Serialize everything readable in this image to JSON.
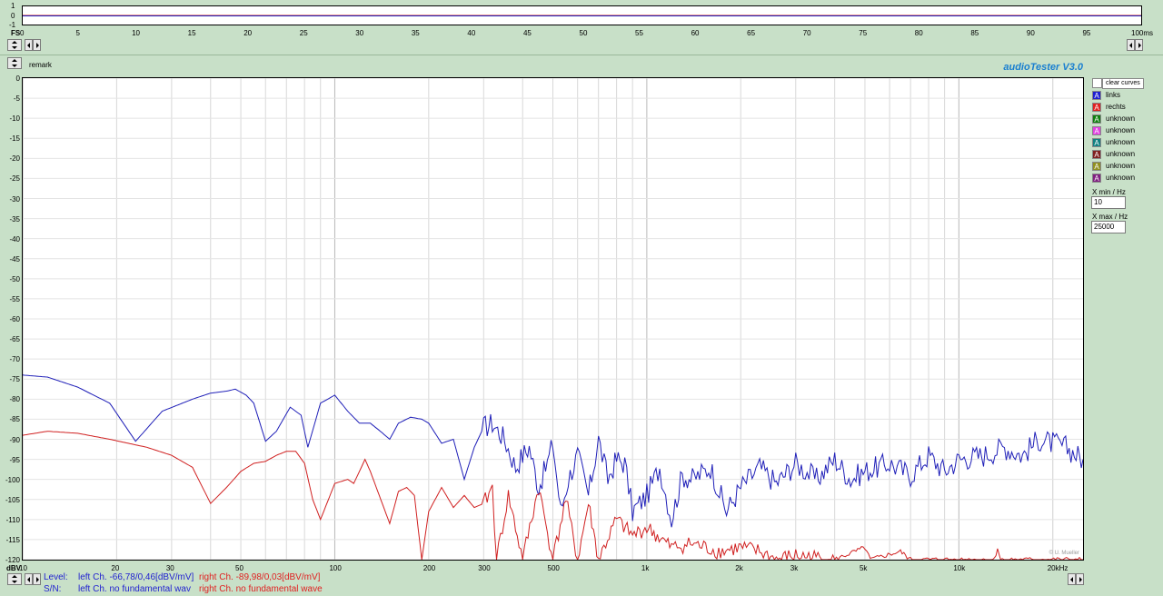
{
  "scope": {
    "fs_label": "FS",
    "y_ticks": [
      "1",
      "0",
      "-1"
    ],
    "x_ticks": [
      "0",
      "5",
      "10",
      "15",
      "20",
      "25",
      "30",
      "35",
      "40",
      "45",
      "50",
      "55",
      "60",
      "65",
      "70",
      "75",
      "80",
      "85",
      "90",
      "95",
      "100ms"
    ]
  },
  "remark_label": "remark",
  "app_title": "audioTester  V3.0",
  "clear_curves_label": "clear curves",
  "legend": [
    {
      "glyph": "A",
      "name": "links",
      "color": "#1f1fd0"
    },
    {
      "glyph": "A",
      "name": "rechts",
      "color": "#e02020"
    },
    {
      "glyph": "A",
      "name": "unknown",
      "color": "#108010"
    },
    {
      "glyph": "A",
      "name": "unknown",
      "color": "#e040e0"
    },
    {
      "glyph": "A",
      "name": "unknown",
      "color": "#108080"
    },
    {
      "glyph": "A",
      "name": "unknown",
      "color": "#802020"
    },
    {
      "glyph": "A",
      "name": "unknown",
      "color": "#909020"
    },
    {
      "glyph": "A",
      "name": "unknown",
      "color": "#802080"
    }
  ],
  "xmin_label": "X min / Hz",
  "xmin_value": "10",
  "xmax_label": "X max / Hz",
  "xmax_value": "25000",
  "watermark": "© U. Mueller",
  "status": {
    "level_label": "Level:",
    "level_left": "left Ch.  -66,78/0,46[dBV/mV]",
    "level_right": "right Ch.  -89,98/0,03[dBV/mV]",
    "sn_label": "S/N:",
    "sn_left": "left Ch.  no fundamental wav",
    "sn_right": "right Ch.  no fundamental wave"
  },
  "chart_data": {
    "type": "line",
    "x_scale": "log",
    "xlim": [
      10,
      25000
    ],
    "ylim": [
      -120,
      0
    ],
    "ylabel": "dBV",
    "x_tick_labels": [
      "10",
      "20",
      "30",
      "50",
      "100",
      "200",
      "300",
      "500",
      "1k",
      "2k",
      "3k",
      "5k",
      "10k",
      "20kHz"
    ],
    "y_tick_labels": [
      "0",
      "-5",
      "-10",
      "-15",
      "-20",
      "-25",
      "-30",
      "-35",
      "-40",
      "-45",
      "-50",
      "-55",
      "-60",
      "-65",
      "-70",
      "-75",
      "-80",
      "-85",
      "-90",
      "-95",
      "-100",
      "-105",
      "-110",
      "-115",
      "-120"
    ],
    "grid": true,
    "series": [
      {
        "name": "links",
        "color": "#1f1fb8",
        "points": [
          [
            10,
            -74
          ],
          [
            12,
            -74.5
          ],
          [
            15,
            -77
          ],
          [
            19,
            -81
          ],
          [
            23,
            -90.5
          ],
          [
            28,
            -83
          ],
          [
            35,
            -80
          ],
          [
            40,
            -78.5
          ],
          [
            45,
            -78
          ],
          [
            48,
            -77.5
          ],
          [
            52,
            -79
          ],
          [
            55,
            -81
          ],
          [
            60,
            -90.5
          ],
          [
            65,
            -88
          ],
          [
            72,
            -82
          ],
          [
            78,
            -84
          ],
          [
            82,
            -92
          ],
          [
            90,
            -81
          ],
          [
            95,
            -80
          ],
          [
            100,
            -79
          ],
          [
            110,
            -83
          ],
          [
            120,
            -86
          ],
          [
            130,
            -86
          ],
          [
            140,
            -88
          ],
          [
            150,
            -90
          ],
          [
            160,
            -86
          ],
          [
            175,
            -84.5
          ],
          [
            190,
            -85
          ],
          [
            200,
            -86
          ],
          [
            220,
            -91
          ],
          [
            240,
            -90
          ],
          [
            260,
            -100
          ],
          [
            280,
            -92
          ],
          [
            300,
            -87
          ],
          [
            320,
            -86
          ],
          [
            350,
            -90
          ],
          [
            380,
            -97
          ],
          [
            400,
            -94
          ],
          [
            420,
            -92
          ],
          [
            450,
            -102
          ],
          [
            480,
            -96
          ],
          [
            500,
            -91
          ],
          [
            530,
            -108
          ],
          [
            560,
            -100
          ],
          [
            600,
            -94
          ],
          [
            650,
            -104
          ],
          [
            700,
            -90
          ],
          [
            750,
            -100
          ],
          [
            800,
            -95
          ],
          [
            850,
            -96
          ],
          [
            900,
            -108
          ],
          [
            1000,
            -104
          ],
          [
            1100,
            -97
          ],
          [
            1200,
            -110
          ],
          [
            1300,
            -99
          ],
          [
            1400,
            -100
          ],
          [
            1600,
            -97
          ],
          [
            1800,
            -108
          ],
          [
            2000,
            -102
          ],
          [
            2300,
            -97
          ],
          [
            2600,
            -101
          ],
          [
            3000,
            -96
          ],
          [
            3500,
            -100
          ],
          [
            4000,
            -95
          ],
          [
            4500,
            -100
          ],
          [
            5000,
            -98
          ],
          [
            6000,
            -96
          ],
          [
            7000,
            -99
          ],
          [
            8000,
            -94
          ],
          [
            9000,
            -98
          ],
          [
            10000,
            -95
          ],
          [
            12000,
            -94
          ],
          [
            14000,
            -92
          ],
          [
            16000,
            -94
          ],
          [
            18000,
            -90
          ],
          [
            20000,
            -91
          ],
          [
            22000,
            -92
          ],
          [
            25000,
            -95
          ]
        ]
      },
      {
        "name": "rechts",
        "color": "#d02020",
        "points": [
          [
            10,
            -89
          ],
          [
            12,
            -88
          ],
          [
            15,
            -88.5
          ],
          [
            19,
            -90
          ],
          [
            25,
            -92
          ],
          [
            30,
            -94
          ],
          [
            35,
            -97
          ],
          [
            40,
            -106
          ],
          [
            45,
            -102
          ],
          [
            50,
            -98
          ],
          [
            55,
            -96
          ],
          [
            60,
            -95.5
          ],
          [
            65,
            -94
          ],
          [
            70,
            -93
          ],
          [
            75,
            -93
          ],
          [
            80,
            -96
          ],
          [
            85,
            -105
          ],
          [
            90,
            -110
          ],
          [
            100,
            -101
          ],
          [
            110,
            -100
          ],
          [
            115,
            -101
          ],
          [
            120,
            -98
          ],
          [
            125,
            -95
          ],
          [
            130,
            -98
          ],
          [
            150,
            -111
          ],
          [
            160,
            -103
          ],
          [
            170,
            -102
          ],
          [
            180,
            -104
          ],
          [
            190,
            -120
          ],
          [
            200,
            -108
          ],
          [
            220,
            -102
          ],
          [
            240,
            -107
          ],
          [
            260,
            -104
          ],
          [
            280,
            -107
          ],
          [
            300,
            -106
          ],
          [
            320,
            -102
          ],
          [
            330,
            -120
          ],
          [
            360,
            -104
          ],
          [
            400,
            -120
          ],
          [
            450,
            -102
          ],
          [
            500,
            -120
          ],
          [
            550,
            -105
          ],
          [
            600,
            -120
          ],
          [
            650,
            -106
          ],
          [
            700,
            -120
          ],
          [
            800,
            -110
          ],
          [
            900,
            -114
          ],
          [
            1000,
            -112
          ],
          [
            1200,
            -117
          ],
          [
            1400,
            -116
          ],
          [
            1700,
            -118
          ],
          [
            2000,
            -117
          ],
          [
            2300,
            -118
          ],
          [
            2600,
            -120
          ],
          [
            3000,
            -119
          ],
          [
            4000,
            -120
          ],
          [
            5000,
            -117
          ],
          [
            5200,
            -120
          ],
          [
            6500,
            -118
          ],
          [
            7000,
            -120
          ],
          [
            13000,
            -120
          ],
          [
            13300,
            -117
          ],
          [
            13600,
            -120
          ],
          [
            25000,
            -120
          ]
        ]
      }
    ]
  }
}
